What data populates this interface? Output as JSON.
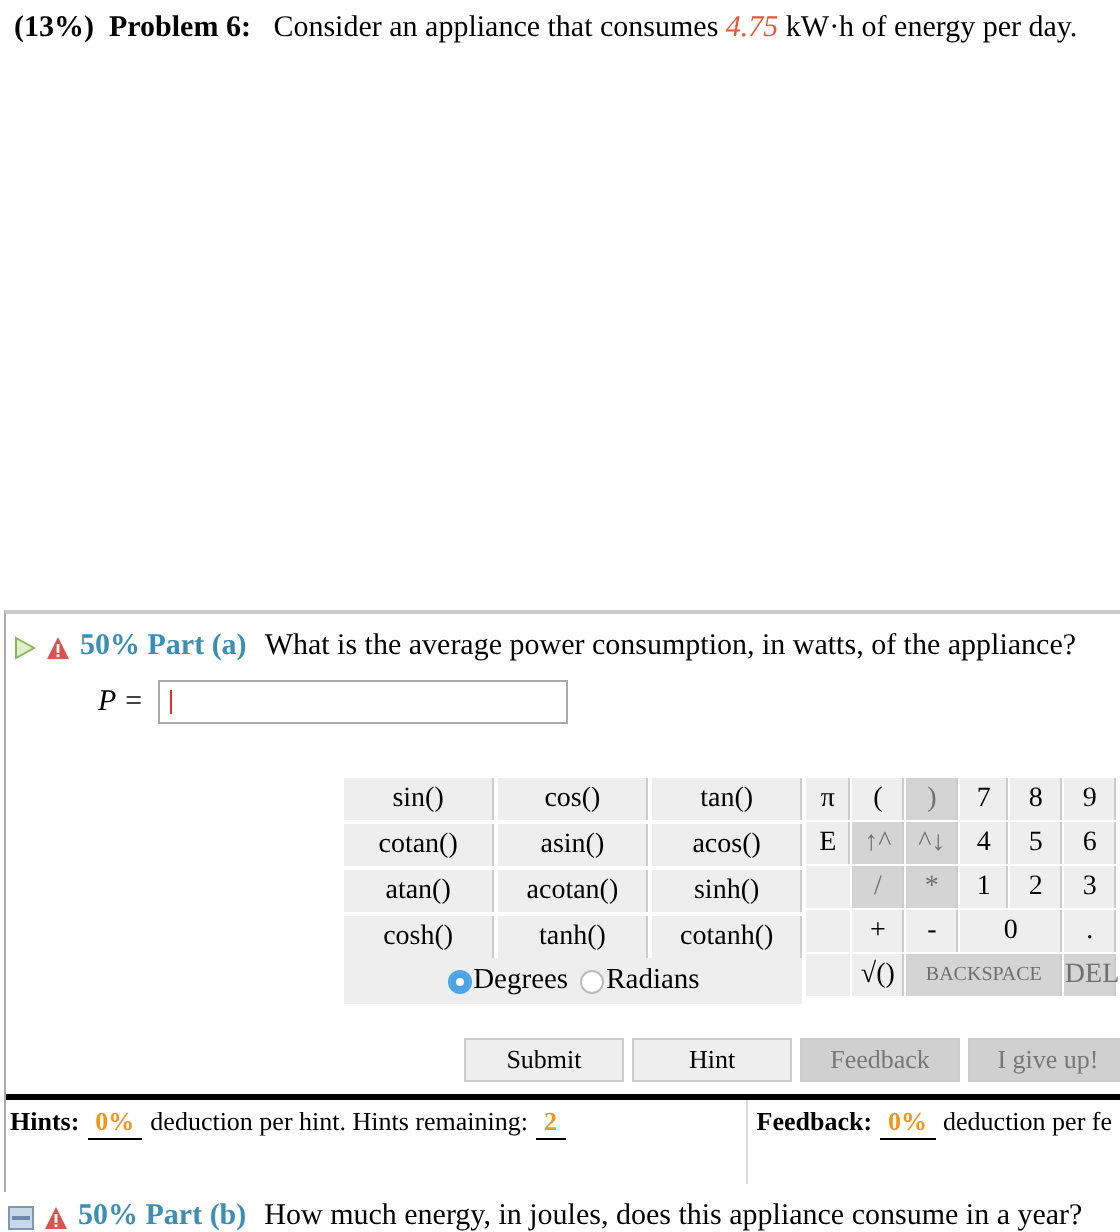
{
  "problem": {
    "weight": "(13%)",
    "label": "Problem 6:",
    "text_before": "Consider an appliance that consumes",
    "value": "4.75",
    "text_after": "kW·h of energy per day."
  },
  "part_a": {
    "percent": "50%",
    "label": "Part (a)",
    "question": "What is the average power consumption, in watts, of the appliance?",
    "variable": "P ="
  },
  "functions": [
    [
      "sin()",
      "cos()",
      "tan()"
    ],
    [
      "cotan()",
      "asin()",
      "acos()"
    ],
    [
      "atan()",
      "acotan()",
      "sinh()"
    ],
    [
      "cosh()",
      "tanh()",
      "cotanh()"
    ]
  ],
  "angle_modes": [
    {
      "label": "Degrees",
      "selected": true
    },
    {
      "label": "Radians",
      "selected": false
    }
  ],
  "keypad": [
    [
      {
        "kind": "key",
        "label": "π",
        "disabled": false
      },
      {
        "kind": "key",
        "label": "(",
        "disabled": false
      },
      {
        "kind": "key",
        "label": ")",
        "disabled": true
      },
      {
        "kind": "key",
        "label": "7",
        "disabled": false
      },
      {
        "kind": "key",
        "label": "8",
        "disabled": false
      },
      {
        "kind": "key",
        "label": "9",
        "disabled": false
      }
    ],
    [
      {
        "kind": "key",
        "label": "E",
        "disabled": false
      },
      {
        "kind": "key",
        "label": "↑^",
        "disabled": true
      },
      {
        "kind": "key",
        "label": "^↓",
        "disabled": true
      },
      {
        "kind": "key",
        "label": "4",
        "disabled": false
      },
      {
        "kind": "key",
        "label": "5",
        "disabled": false
      },
      {
        "kind": "key",
        "label": "6",
        "disabled": false
      }
    ],
    [
      {
        "kind": "blank"
      },
      {
        "kind": "key",
        "label": "/",
        "disabled": true
      },
      {
        "kind": "key",
        "label": "*",
        "disabled": true
      },
      {
        "kind": "key",
        "label": "1",
        "disabled": false
      },
      {
        "kind": "key",
        "label": "2",
        "disabled": false
      },
      {
        "kind": "key",
        "label": "3",
        "disabled": false
      }
    ],
    [
      {
        "kind": "blank"
      },
      {
        "kind": "key",
        "label": "+",
        "disabled": false
      },
      {
        "kind": "key",
        "label": "-",
        "disabled": false
      },
      {
        "kind": "double",
        "label": "0",
        "disabled": false
      },
      {
        "kind": "key",
        "label": ".",
        "disabled": false
      }
    ],
    [
      {
        "kind": "blank"
      },
      {
        "kind": "key",
        "label": "√()",
        "disabled": false
      },
      {
        "kind": "triple",
        "label": "BACKSPACE",
        "disabled": true
      },
      {
        "kind": "key",
        "label": "DEL",
        "disabled": true
      }
    ]
  ],
  "buttons": [
    {
      "label": "Submit",
      "disabled": false
    },
    {
      "label": "Hint",
      "disabled": false
    },
    {
      "label": "Feedback",
      "disabled": true
    },
    {
      "label": "I give up!",
      "disabled": true
    }
  ],
  "hints": {
    "label": "Hints:",
    "deduction": "0%",
    "text": "deduction per hint. Hints remaining:",
    "remaining": "2"
  },
  "feedback": {
    "label": "Feedback:",
    "deduction": "0%",
    "text": "deduction per fe"
  },
  "part_b": {
    "percent": "50%",
    "label": "Part (b)",
    "question": "How much energy, in joules, does this appliance consume in a year?"
  }
}
